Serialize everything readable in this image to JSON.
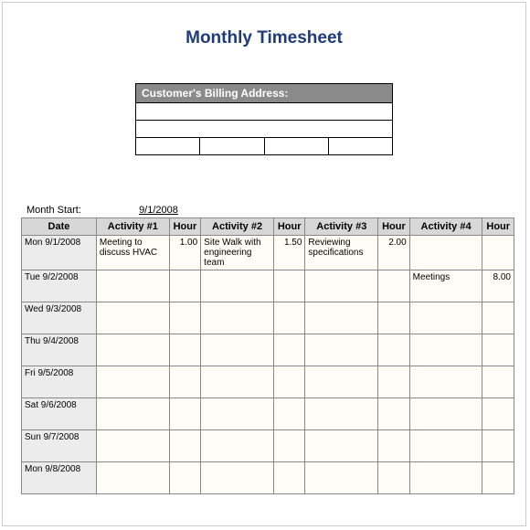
{
  "title": "Monthly Timesheet",
  "billing_header": "Customer's Billing Address:",
  "month_start_label": "Month Start:",
  "month_start_value": "9/1/2008",
  "columns": {
    "date": "Date",
    "act1": "Activity #1",
    "h1": "Hour",
    "act2": "Activity #2",
    "h2": "Hour",
    "act3": "Activity #3",
    "h3": "Hour",
    "act4": "Activity #4",
    "h4": "Hour"
  },
  "rows": [
    {
      "date": "Mon 9/1/2008",
      "a1": "Meeting to discuss HVAC",
      "h1": "1.00",
      "a2": "Site Walk with engineering team",
      "h2": "1.50",
      "a3": "Reviewing specifications",
      "h3": "2.00",
      "a4": "",
      "h4": ""
    },
    {
      "date": "Tue 9/2/2008",
      "a1": "",
      "h1": "",
      "a2": "",
      "h2": "",
      "a3": "",
      "h3": "",
      "a4": "Meetings",
      "h4": "8.00"
    },
    {
      "date": "Wed 9/3/2008",
      "a1": "",
      "h1": "",
      "a2": "",
      "h2": "",
      "a3": "",
      "h3": "",
      "a4": "",
      "h4": ""
    },
    {
      "date": "Thu 9/4/2008",
      "a1": "",
      "h1": "",
      "a2": "",
      "h2": "",
      "a3": "",
      "h3": "",
      "a4": "",
      "h4": ""
    },
    {
      "date": "Fri 9/5/2008",
      "a1": "",
      "h1": "",
      "a2": "",
      "h2": "",
      "a3": "",
      "h3": "",
      "a4": "",
      "h4": ""
    },
    {
      "date": "Sat 9/6/2008",
      "a1": "",
      "h1": "",
      "a2": "",
      "h2": "",
      "a3": "",
      "h3": "",
      "a4": "",
      "h4": ""
    },
    {
      "date": "Sun 9/7/2008",
      "a1": "",
      "h1": "",
      "a2": "",
      "h2": "",
      "a3": "",
      "h3": "",
      "a4": "",
      "h4": ""
    },
    {
      "date": "Mon 9/8/2008",
      "a1": "",
      "h1": "",
      "a2": "",
      "h2": "",
      "a3": "",
      "h3": "",
      "a4": "",
      "h4": ""
    }
  ]
}
